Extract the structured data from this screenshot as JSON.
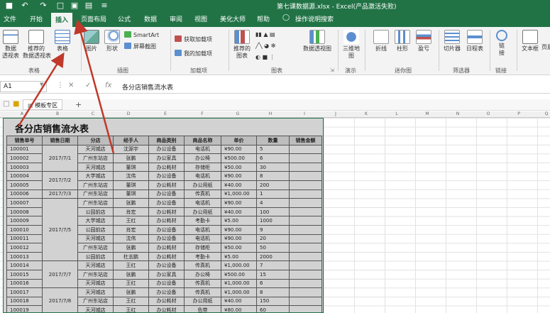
{
  "window": {
    "title": "第七课数据源.xlsx  -  Excel(产品激活失败)"
  },
  "quick_access": {
    "save_label": "■",
    "undo_label": "↶",
    "redo_label": "↷",
    "new_label": "□",
    "preview_label": "▣",
    "form_label": "▤",
    "customize_label": "≡"
  },
  "tabs": [
    {
      "label": "文件"
    },
    {
      "label": "开始"
    },
    {
      "label": "插入"
    },
    {
      "label": "页面布局"
    },
    {
      "label": "公式"
    },
    {
      "label": "数据"
    },
    {
      "label": "审阅"
    },
    {
      "label": "视图"
    },
    {
      "label": "美化大师"
    },
    {
      "label": "帮助"
    },
    {
      "label": "操作说明搜索"
    }
  ],
  "ribbon": {
    "pivot_table": "数据\n透视表",
    "recommended_pivot": "推荐的\n数据透视表",
    "table": "表格",
    "pictures": "图片",
    "shapes": "形状",
    "smartart": "SmartArt",
    "screenshot": "屏幕截图",
    "get_addins": "获取加载项",
    "my_addins": "我的加载项",
    "recommended_charts": "推荐的\n图表",
    "pivot_chart": "数据透视图",
    "map_3d": "三维地\n图",
    "line": "折线",
    "column": "柱形",
    "win_loss": "盈亏",
    "slicer": "切片器",
    "timeline": "日程表",
    "link": "链\n接",
    "textbox": "文本框",
    "header_footer": "页眉"
  },
  "groups": {
    "tables": "表格",
    "illustrations": "插图",
    "addins": "加载项",
    "charts": "图表",
    "tours": "演示",
    "sparklines": "迷你图",
    "filters": "筛选器",
    "links": "链接"
  },
  "formula_bar": {
    "name_box": "A1",
    "cancel": "✕",
    "confirm": "✓",
    "fx": "fx",
    "content": "各分店销售流水表"
  },
  "sheet_tabs": {
    "template_area": "模板专区",
    "add": "+"
  },
  "columns": [
    "A",
    "B",
    "C",
    "D",
    "E",
    "F",
    "G",
    "H",
    "I",
    "J",
    "K",
    "L",
    "M",
    "N",
    "O",
    "P",
    "Q"
  ],
  "sheet": {
    "title": "各分店销售流水表",
    "headers": [
      "销售单号",
      "销售日期",
      "分店",
      "经手人",
      "商品类别",
      "商品名称",
      "单价",
      "数量",
      "销售金额"
    ],
    "rows": [
      [
        "100001",
        "",
        "天河城店",
        "沈源宇",
        "办公设备",
        "电话机",
        "¥90.00",
        "5",
        ""
      ],
      [
        "100002",
        "2017/7/1",
        "广州东站店",
        "张鹏",
        "办公家具",
        "办公椅",
        "¥500.00",
        "6",
        ""
      ],
      [
        "100003",
        "",
        "天河城店",
        "董琪",
        "办公耗材",
        "存储柜",
        "¥50.00",
        "30",
        ""
      ],
      [
        "100004",
        "2017/7/2",
        "大学城店",
        "沈伟",
        "办公设备",
        "电话机",
        "¥90.00",
        "8",
        ""
      ],
      [
        "100005",
        "",
        "广州东站店",
        "董琪",
        "办公耗材",
        "办公用纸",
        "¥40.00",
        "200",
        ""
      ],
      [
        "100006",
        "2017/7/3",
        "广州东站店",
        "董琪",
        "办公设备",
        "传真机",
        "¥1,000.00",
        "1",
        ""
      ],
      [
        "100007",
        "",
        "广州东站店",
        "张鹏",
        "办公设备",
        "电话机",
        "¥90.00",
        "4",
        ""
      ],
      [
        "100008",
        "",
        "公园前店",
        "肖宏",
        "办公耗材",
        "办公用纸",
        "¥40.00",
        "100",
        ""
      ],
      [
        "100009",
        "",
        "大学城店",
        "王红",
        "办公耗材",
        "考勤卡",
        "¥5.00",
        "1000",
        ""
      ],
      [
        "100010",
        "2017/7/5",
        "公园前店",
        "肖宏",
        "办公设备",
        "电话机",
        "¥90.00",
        "9",
        ""
      ],
      [
        "100011",
        "",
        "天河城店",
        "沈伟",
        "办公设备",
        "电话机",
        "¥90.00",
        "20",
        ""
      ],
      [
        "100012",
        "",
        "广州东站店",
        "张鹏",
        "办公耗材",
        "存储柜",
        "¥50.00",
        "50",
        ""
      ],
      [
        "100013",
        "",
        "公园前店",
        "杜志鹏",
        "办公耗材",
        "考勤卡",
        "¥5.00",
        "2000",
        ""
      ],
      [
        "100014",
        "",
        "天河城店",
        "王红",
        "办公设备",
        "传真机",
        "¥1,000.00",
        "7",
        ""
      ],
      [
        "100015",
        "2017/7/7",
        "广州东站店",
        "张鹏",
        "办公家具",
        "办公椅",
        "¥500.00",
        "15",
        ""
      ],
      [
        "100016",
        "",
        "天河城店",
        "王红",
        "办公设备",
        "传真机",
        "¥1,000.00",
        "6",
        ""
      ],
      [
        "100017",
        "",
        "天河城店",
        "张鹏",
        "办公设备",
        "传真机",
        "¥1,000.00",
        "8",
        ""
      ],
      [
        "100018",
        "2017/7/8",
        "广州东站店",
        "王红",
        "办公耗材",
        "办公用纸",
        "¥40.00",
        "150",
        ""
      ],
      [
        "100019",
        "",
        "天河城店",
        "王红",
        "办公耗材",
        "色带",
        "¥80.00",
        "60",
        ""
      ]
    ]
  },
  "colors": {
    "brand_green": "#217346",
    "arrow_red": "#c0392b"
  }
}
